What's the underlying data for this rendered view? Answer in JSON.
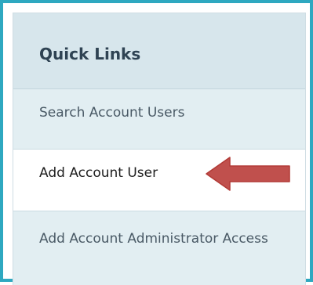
{
  "quick_links": {
    "title": "Quick Links",
    "items": [
      {
        "label": "Search Account Users"
      },
      {
        "label": "Add Account User"
      },
      {
        "label": "Add Account Administrator Access"
      }
    ]
  },
  "colors": {
    "frame_border": "#2ea8c0",
    "header_bg": "#d7e6ec",
    "item_bg": "#e2eef2",
    "selected_item_bg": "#ffffff",
    "arrow": "#c0504d"
  },
  "annotation": {
    "arrow_icon": "left-arrow-icon"
  }
}
